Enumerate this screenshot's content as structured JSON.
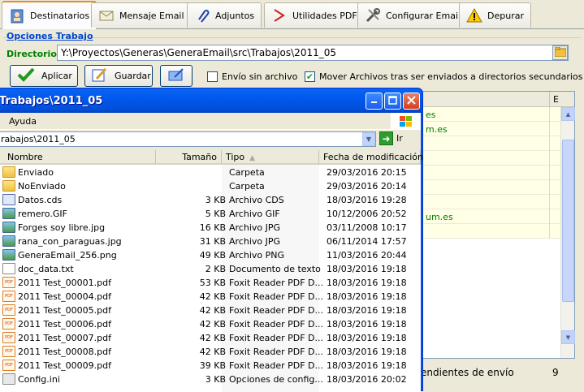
{
  "tabs": [
    {
      "label": "Destinatarios",
      "icon": "address-book-icon"
    },
    {
      "label": "Mensaje Email",
      "icon": "envelope-icon"
    },
    {
      "label": "Adjuntos",
      "icon": "paperclip-icon"
    },
    {
      "label": "Utilidades PDF",
      "icon": "pdf-icon"
    },
    {
      "label": "Configurar Email",
      "icon": "tools-icon"
    },
    {
      "label": "Depurar",
      "icon": "warning-icon"
    }
  ],
  "options": {
    "group_title": "Opciones Trabajo",
    "dir_label": "Directorio:",
    "dir_value": "Y:\\Proyectos\\Generas\\GeneraEmail\\src\\Trabajos\\2011_05",
    "apply_label": "Aplicar",
    "save_label": "Guardar",
    "chk_noattach_label": "Envío sin archivo",
    "chk_noattach_checked": false,
    "chk_move_label": "Mover Archivos tras ser enviados a directorios secundarios",
    "chk_move_checked": true
  },
  "bg_table": {
    "header_last": "E",
    "rows_visible_fragments": [
      "es",
      "m.es",
      "",
      "",
      "",
      "",
      "",
      "um.es",
      ""
    ]
  },
  "status": {
    "pending_text": "endientes de envío",
    "pending_count": "9"
  },
  "explorer": {
    "title": "Trabajos\\2011_05",
    "menu": [
      "Ayuda"
    ],
    "address": "rabajos\\2011_05",
    "go_label": "Ir",
    "columns": {
      "name": "Nombre",
      "size": "Tamaño",
      "type": "Tipo",
      "date": "Fecha de modificación"
    },
    "files": [
      {
        "name": "Enviado",
        "size": "",
        "type": "Carpeta",
        "date": "29/03/2016 20:15",
        "icon": "folder"
      },
      {
        "name": "NoEnviado",
        "size": "",
        "type": "Carpeta",
        "date": "29/03/2016 20:14",
        "icon": "folder"
      },
      {
        "name": "Datos.cds",
        "size": "3 KB",
        "type": "Archivo CDS",
        "date": "18/03/2016 19:28",
        "icon": "cds"
      },
      {
        "name": "remero.GIF",
        "size": "5 KB",
        "type": "Archivo GIF",
        "date": "10/12/2006 20:52",
        "icon": "img"
      },
      {
        "name": "Forges soy libre.jpg",
        "size": "16 KB",
        "type": "Archivo JPG",
        "date": "03/11/2008 10:17",
        "icon": "img"
      },
      {
        "name": "rana_con_paraguas.jpg",
        "size": "31 KB",
        "type": "Archivo JPG",
        "date": "06/11/2014 17:57",
        "icon": "img"
      },
      {
        "name": "GeneraEmail_256.png",
        "size": "49 KB",
        "type": "Archivo PNG",
        "date": "11/03/2016 20:44",
        "icon": "img"
      },
      {
        "name": "doc_data.txt",
        "size": "2 KB",
        "type": "Documento de texto",
        "date": "18/03/2016 19:18",
        "icon": "doc"
      },
      {
        "name": "2011 Test_00001.pdf",
        "size": "53 KB",
        "type": "Foxit Reader PDF D...",
        "date": "18/03/2016 19:18",
        "icon": "pdf"
      },
      {
        "name": "2011 Test_00004.pdf",
        "size": "42 KB",
        "type": "Foxit Reader PDF D...",
        "date": "18/03/2016 19:18",
        "icon": "pdf"
      },
      {
        "name": "2011 Test_00005.pdf",
        "size": "42 KB",
        "type": "Foxit Reader PDF D...",
        "date": "18/03/2016 19:18",
        "icon": "pdf"
      },
      {
        "name": "2011 Test_00006.pdf",
        "size": "42 KB",
        "type": "Foxit Reader PDF D...",
        "date": "18/03/2016 19:18",
        "icon": "pdf"
      },
      {
        "name": "2011 Test_00007.pdf",
        "size": "42 KB",
        "type": "Foxit Reader PDF D...",
        "date": "18/03/2016 19:18",
        "icon": "pdf"
      },
      {
        "name": "2011 Test_00008.pdf",
        "size": "42 KB",
        "type": "Foxit Reader PDF D...",
        "date": "18/03/2016 19:18",
        "icon": "pdf"
      },
      {
        "name": "2011 Test_00009.pdf",
        "size": "39 KB",
        "type": "Foxit Reader PDF D...",
        "date": "18/03/2016 19:18",
        "icon": "pdf"
      },
      {
        "name": "Config.ini",
        "size": "3 KB",
        "type": "Opciones de config...",
        "date": "18/03/2016 20:02",
        "icon": "cfg"
      }
    ]
  }
}
